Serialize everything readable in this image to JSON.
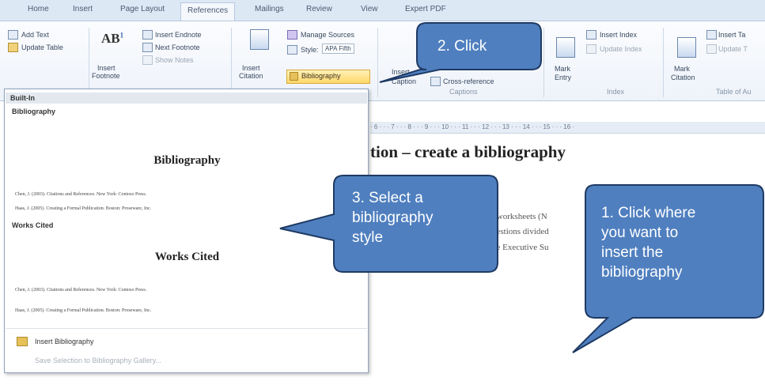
{
  "tabs": [
    "Home",
    "Insert",
    "Page Layout",
    "References",
    "Mailings",
    "Review",
    "View",
    "Expert PDF"
  ],
  "ribbon": {
    "add_text": "Add Text",
    "update_table": "Update Table",
    "insert_footnote": [
      "Insert",
      "Footnote"
    ],
    "insert_endnote": "Insert Endnote",
    "next_footnote": "Next Footnote",
    "show_notes": "Show Notes",
    "insert_citation": [
      "Insert",
      "Citation"
    ],
    "manage_sources": "Manage Sources",
    "style_label": "Style:",
    "style_value": "APA Fifth",
    "bibliography": "Bibliography",
    "insert_caption": [
      "Insert",
      "Caption"
    ],
    "cross_reference": "Cross-reference",
    "captions_group": "Captions",
    "mark_entry": [
      "Mark",
      "Entry"
    ],
    "insert_index": "Insert Index",
    "update_index": "Update Index",
    "index_group": "Index",
    "mark_citation": [
      "Mark",
      "Citation"
    ],
    "insert_table_auth": "Insert Ta",
    "update_table2": "Update T",
    "table_auth_group": "Table of Au"
  },
  "ruler_text": "· 6 · · · 7 · · · 8 · · · 9 · · · 10 · · · 11 · · · 12 · · · 13 · · · 14 · · · 15 · · · 16 ·",
  "document": {
    "heading": "tion – create a bibliography",
    "line1": "l worksheets (N",
    "line2": "uestions divided",
    "line3": "he Executive Su"
  },
  "dropdown": {
    "built_in": "Built-In",
    "bib_label": "Bibliography",
    "bib_title": "Bibliography",
    "works_label": "Works Cited",
    "works_title": "Works Cited",
    "ref1": "Chen, J. (2003). Citations and References. New York: Contoso Press.",
    "ref2": "Haas, J. (2005). Creating a Formal Publication. Boston: Proseware, Inc.",
    "insert_bibliography": "Insert Bibliography",
    "save_selection": "Save Selection to Bibliography Gallery..."
  },
  "callouts": {
    "c1": [
      "1. Click where",
      "you want to",
      "insert the",
      "bibliography"
    ],
    "c2": [
      "2. Click"
    ],
    "c3": [
      "3. Select a",
      "bibliography",
      "style"
    ],
    "fill": "#4f7fbf",
    "stroke": "#1f3a64"
  }
}
